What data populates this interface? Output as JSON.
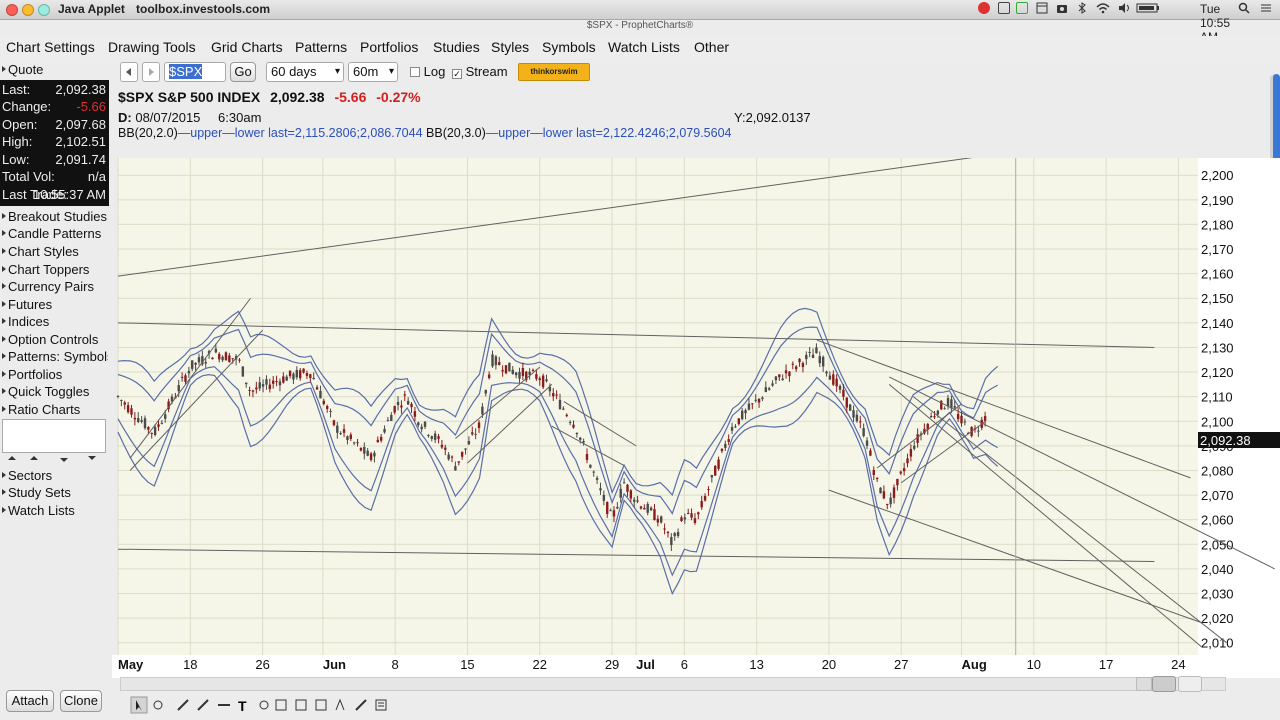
{
  "os": {
    "app_title": "Java Applet",
    "window_menu": "toolbox.investools.com",
    "window_title": "$SPX - ProphetCharts®",
    "clock": "Tue 10:55 AM"
  },
  "menu": [
    "Chart Settings",
    "Drawing Tools",
    "Grid Charts",
    "Patterns",
    "Portfolios",
    "Studies",
    "Styles",
    "Symbols",
    "Watch Lists",
    "Other"
  ],
  "sidebar": {
    "quote_label": "Quote",
    "quote": [
      {
        "k": "Last:",
        "v": "2,092.38"
      },
      {
        "k": "Change:",
        "v": "-5.66"
      },
      {
        "k": "Open:",
        "v": "2,097.68"
      },
      {
        "k": "High:",
        "v": "2,102.51"
      },
      {
        "k": "Low:",
        "v": "2,091.74"
      },
      {
        "k": "Total Vol:",
        "v": "n/a"
      },
      {
        "k": "Last Trade:",
        "v": "10:55:37 AM"
      }
    ],
    "items_top": [
      "Breakout Studies",
      "Candle Patterns",
      "Chart Styles",
      "Chart Toppers",
      "Currency Pairs",
      "Futures",
      "Indices",
      "Option Controls",
      "Patterns: Symbols",
      "Portfolios",
      "Quick Toggles",
      "Ratio Charts"
    ],
    "items_bottom": [
      "Sectors",
      "Study Sets",
      "Watch Lists"
    ],
    "attach_label": "Attach",
    "clone_label": "Clone"
  },
  "toolbar": {
    "symbol": "$SPX",
    "go_label": "Go",
    "period": "60 days",
    "interval": "60m",
    "log_label": "Log",
    "stream_label": "Stream",
    "stream_checked": true,
    "thinkorswim_label": "thinkorswim"
  },
  "chart_header": {
    "symbol": "$SPX",
    "name": "S&P 500 INDEX",
    "last": "2,092.38",
    "change": "-5.66",
    "change_pct": "-0.27%",
    "date_label": "D:",
    "date": "08/07/2015",
    "time": "6:30am",
    "y_label": "Y:2,092.0137",
    "bb1": "BB(20,2.0)",
    "bb1_rest": "last=2,115.2806;2,086.7044",
    "bb2": "BB(20,3.0)",
    "bb2_rest": "last=2,122.4246;2,079.5604",
    "upper": "upper",
    "lower": "lower"
  },
  "chart_data": {
    "type": "candlestick",
    "x_labels": [
      "May",
      "18",
      "26",
      "Jun",
      "8",
      "15",
      "22",
      "29",
      "Jul",
      "6",
      "13",
      "20",
      "27",
      "Aug",
      "10",
      "17",
      "24"
    ],
    "y_ticks": [
      2010,
      2020,
      2030,
      2040,
      2050,
      2060,
      2070,
      2080,
      2090,
      2100,
      2110,
      2120,
      2130,
      2140,
      2150,
      2160,
      2170,
      2180,
      2190,
      2200
    ],
    "ylim": [
      2005,
      2207
    ],
    "last_price": 2092.38,
    "last_price_label": "2,092.38",
    "price_path": [
      {
        "d": 0,
        "p": 2110
      },
      {
        "d": 3,
        "p": 2095
      },
      {
        "d": 6,
        "p": 2122
      },
      {
        "d": 8,
        "p": 2128
      },
      {
        "d": 10,
        "p": 2125
      },
      {
        "d": 11,
        "p": 2112
      },
      {
        "d": 14,
        "p": 2118
      },
      {
        "d": 16,
        "p": 2120
      },
      {
        "d": 18,
        "p": 2098
      },
      {
        "d": 21,
        "p": 2085
      },
      {
        "d": 23,
        "p": 2106
      },
      {
        "d": 24,
        "p": 2110
      },
      {
        "d": 25,
        "p": 2100
      },
      {
        "d": 27,
        "p": 2090
      },
      {
        "d": 28,
        "p": 2082
      },
      {
        "d": 30,
        "p": 2098
      },
      {
        "d": 31,
        "p": 2125
      },
      {
        "d": 33,
        "p": 2120
      },
      {
        "d": 35,
        "p": 2118
      },
      {
        "d": 36,
        "p": 2112
      },
      {
        "d": 38,
        "p": 2098
      },
      {
        "d": 40,
        "p": 2072
      },
      {
        "d": 41,
        "p": 2060
      },
      {
        "d": 42,
        "p": 2075
      },
      {
        "d": 43,
        "p": 2068
      },
      {
        "d": 45,
        "p": 2060
      },
      {
        "d": 46,
        "p": 2050
      },
      {
        "d": 47,
        "p": 2062
      },
      {
        "d": 48,
        "p": 2060
      },
      {
        "d": 50,
        "p": 2085
      },
      {
        "d": 51,
        "p": 2098
      },
      {
        "d": 53,
        "p": 2108
      },
      {
        "d": 55,
        "p": 2118
      },
      {
        "d": 57,
        "p": 2125
      },
      {
        "d": 58,
        "p": 2128
      },
      {
        "d": 60,
        "p": 2112
      },
      {
        "d": 62,
        "p": 2095
      },
      {
        "d": 63,
        "p": 2075
      },
      {
        "d": 64,
        "p": 2066
      },
      {
        "d": 66,
        "p": 2090
      },
      {
        "d": 68,
        "p": 2105
      },
      {
        "d": 69,
        "p": 2108
      },
      {
        "d": 70,
        "p": 2100
      },
      {
        "d": 71,
        "p": 2095
      },
      {
        "d": 72,
        "p": 2102
      }
    ]
  },
  "colors": {
    "bg": "#f6f6e8",
    "grid": "#dcdcc8",
    "band": "#5a6ea8",
    "trend": "#606060",
    "down": "#8b1c1c",
    "up": "#4a4a4a"
  }
}
